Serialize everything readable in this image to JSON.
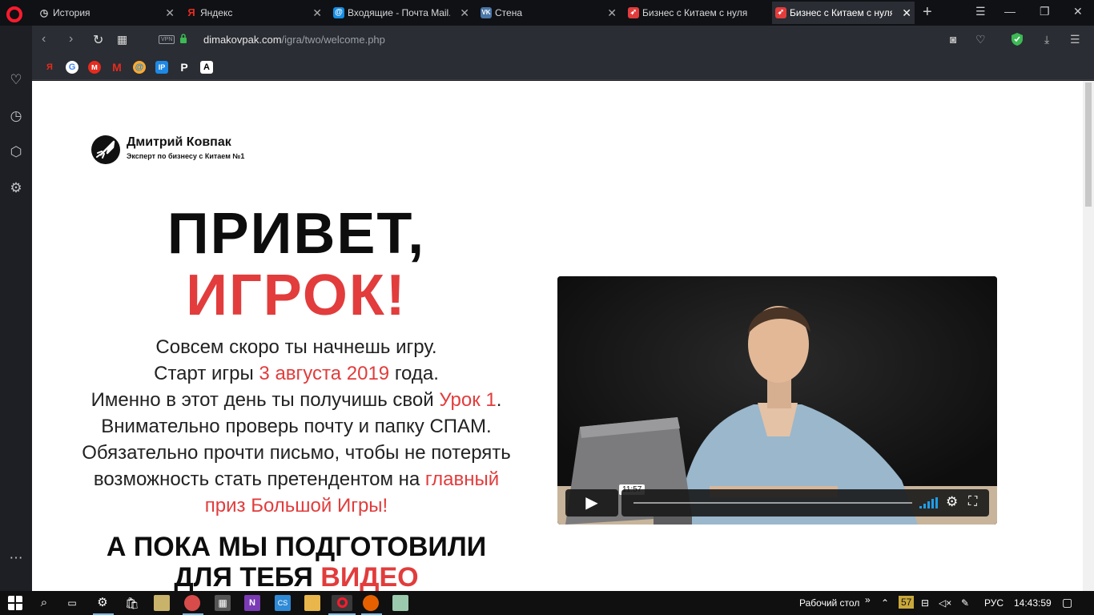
{
  "browser": {
    "tabs": [
      {
        "title": "История",
        "icon": "clock-icon",
        "active": false
      },
      {
        "title": "Яндекс",
        "icon": "yandex-icon",
        "active": false
      },
      {
        "title": "Входящие - Почта Mail.Ru",
        "icon": "mailru-icon",
        "active": false
      },
      {
        "title": "Стена",
        "icon": "vk-icon",
        "active": false
      },
      {
        "title": "Бизнес с Китаем с нуля",
        "icon": "rocket-icon",
        "active": false
      },
      {
        "title": "Бизнес с Китаем с нуля",
        "icon": "rocket-icon",
        "active": true
      }
    ],
    "address": {
      "vpn_label": "VPN",
      "domain": "dimakovpak.com",
      "path": "/igra/two/welcome.php"
    },
    "bookmarks": [
      {
        "label": "Я",
        "color": "#e62b1e"
      },
      {
        "label": "G",
        "color": "#ffffff"
      },
      {
        "label": "м",
        "color": "#e62b1e"
      },
      {
        "label": "M",
        "color": "#e62b1e"
      },
      {
        "label": "@",
        "color": "#168de2"
      },
      {
        "label": "IP",
        "color": "#1e88e5"
      },
      {
        "label": "P",
        "color": "#ffffff"
      },
      {
        "label": "A",
        "color": "#000000"
      }
    ]
  },
  "page": {
    "brand": {
      "name": "Дмитрий Ковпак",
      "tagline": "Эксперт по бизнесу с Китаем №1"
    },
    "hero": {
      "line1": "ПРИВЕТ,",
      "line2": "ИГРОК!"
    },
    "intro": {
      "l1": "Совсем скоро ты начнешь игру.",
      "l2_pre": "Старт игры ",
      "l2_accent": "3 августа 2019",
      "l2_post": " года.",
      "l3_pre": "Именно в этот день ты получишь свой ",
      "l3_accent": "Урок 1",
      "l3_post": ".",
      "l4": "Внимательно проверь почту и папку СПАМ.",
      "l5": "Обязательно прочти письмо, чтобы не потерять",
      "l6_pre": "возможность стать претендентом на ",
      "l6_accent": "главный",
      "l7_accent": "приз Большой Игры",
      "l7_post": "!"
    },
    "subhead": {
      "line1": "А ПОКА МЫ ПОДГОТОВИЛИ",
      "line2_pre": "ДЛЯ ТЕБЯ ",
      "line2_accent": "ВИДЕО"
    },
    "video": {
      "duration": "11:57",
      "progress": 0.0
    },
    "accent_color": "#e23c3c"
  },
  "taskbar": {
    "desktop_label": "Рабочий стол",
    "desktop_chevron": "»",
    "tray_number": "57",
    "language": "РУС",
    "time": "14:43:59"
  }
}
